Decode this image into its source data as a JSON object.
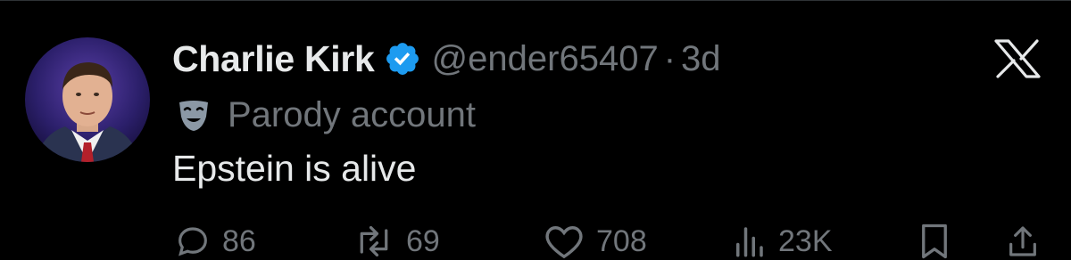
{
  "tweet": {
    "author": {
      "display_name": "Charlie Kirk",
      "handle": "@ender65407",
      "separator": "·",
      "time_ago": "3d"
    },
    "account_label": "Parody account",
    "text": "Epstein is alive",
    "stats": {
      "replies": "86",
      "reposts": "69",
      "likes": "708",
      "views": "23K"
    }
  },
  "colors": {
    "background": "#000000",
    "primary_text": "#e7e9ea",
    "secondary_text": "#71767b",
    "verified_badge": "#1d9bf0"
  },
  "icons": [
    "verified-badge-icon",
    "x-logo-icon",
    "parody-mask-icon",
    "reply-icon",
    "repost-icon",
    "like-icon",
    "views-icon",
    "bookmark-icon",
    "share-icon"
  ]
}
